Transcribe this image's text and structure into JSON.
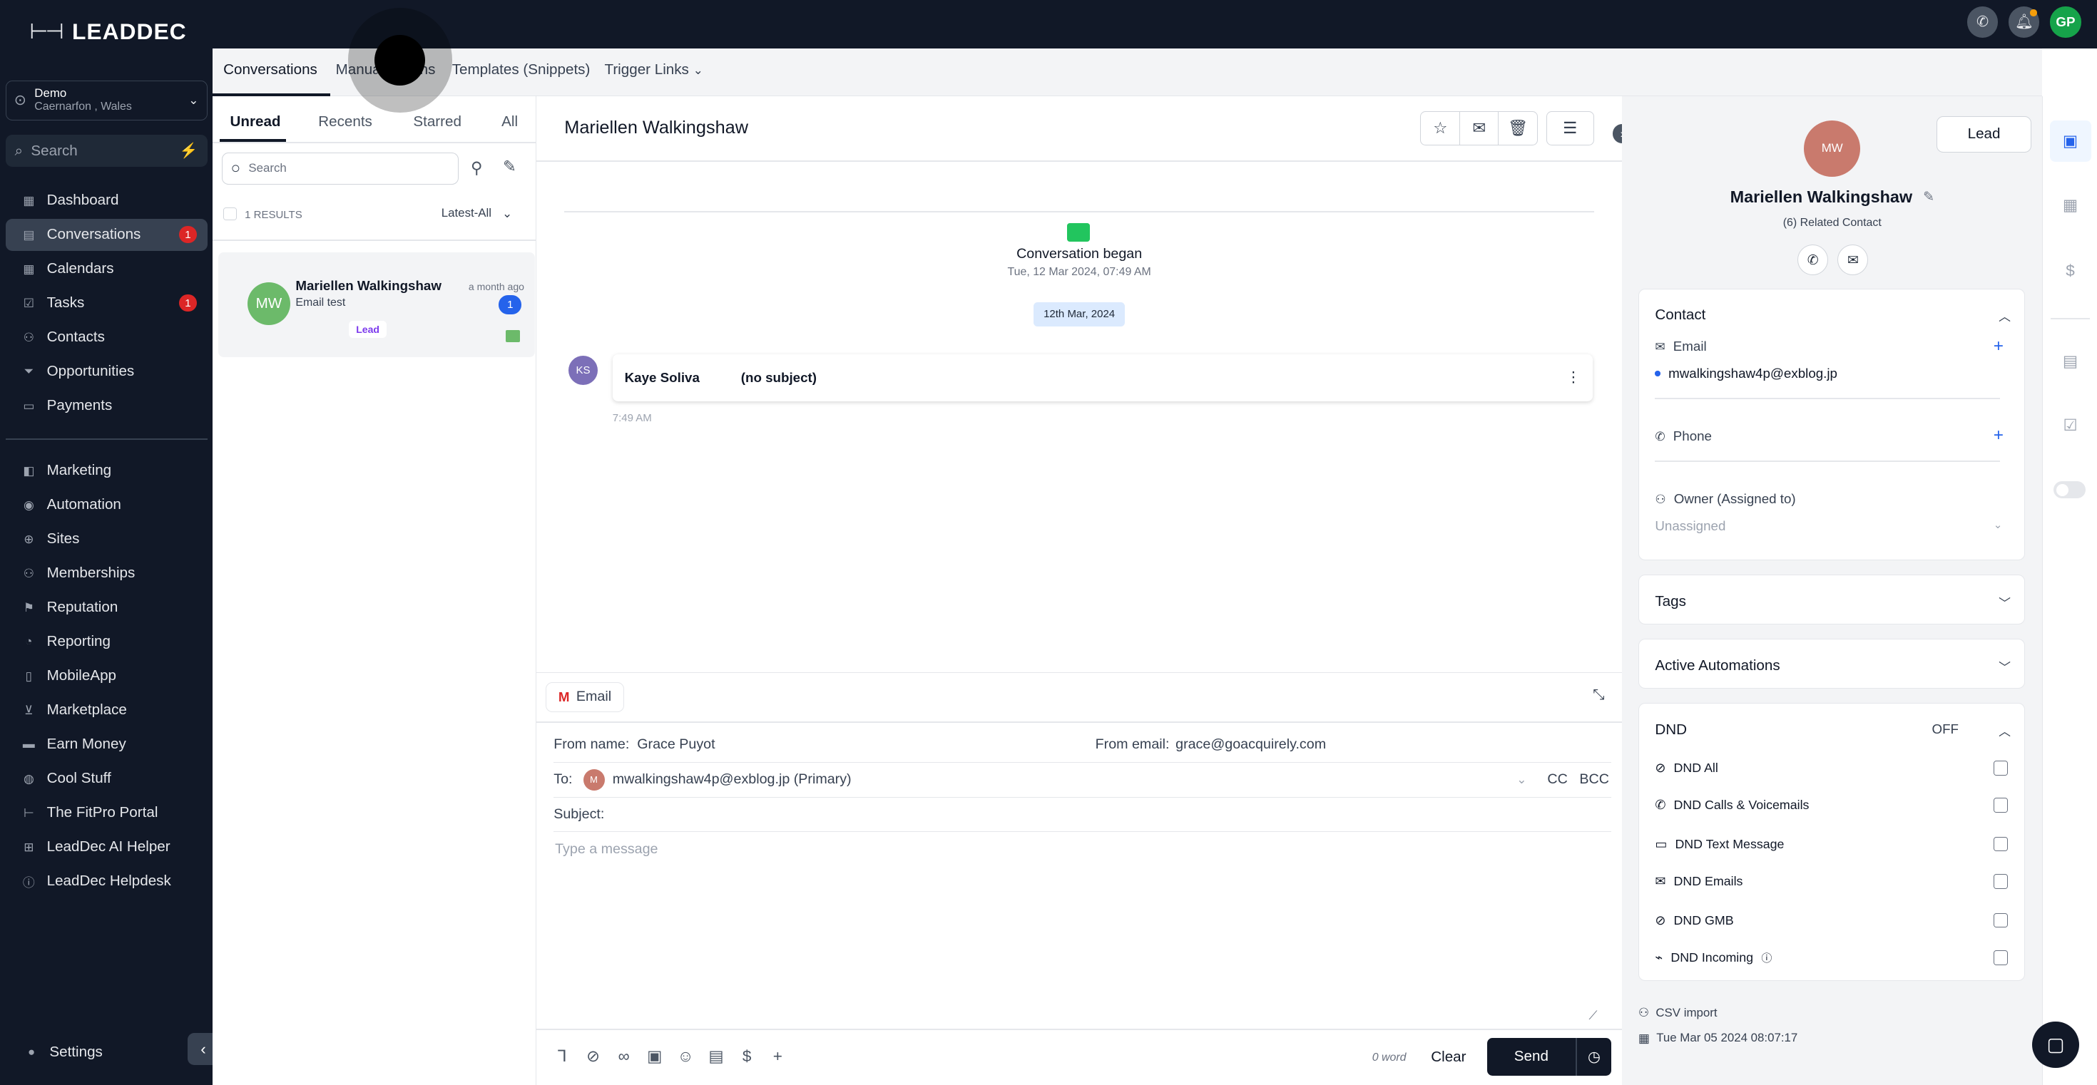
{
  "brand": {
    "logo_text": "LEADDEC"
  },
  "location": {
    "name": "Demo",
    "sub": "Caernarfon , Wales"
  },
  "sidebar_search_placeholder": "Search",
  "nav": [
    {
      "label": "Dashboard",
      "icon": "dashboard-icon"
    },
    {
      "label": "Conversations",
      "icon": "conversations-icon",
      "badge": "1",
      "active": true
    },
    {
      "label": "Calendars",
      "icon": "calendar-icon"
    },
    {
      "label": "Tasks",
      "icon": "tasks-icon",
      "badge": "1"
    },
    {
      "label": "Contacts",
      "icon": "contacts-icon"
    },
    {
      "label": "Opportunities",
      "icon": "opportunities-icon"
    },
    {
      "label": "Payments",
      "icon": "payments-icon"
    },
    {
      "label": "Marketing",
      "icon": "marketing-icon"
    },
    {
      "label": "Automation",
      "icon": "automation-icon"
    },
    {
      "label": "Sites",
      "icon": "sites-icon"
    },
    {
      "label": "Memberships",
      "icon": "memberships-icon"
    },
    {
      "label": "Reputation",
      "icon": "reputation-icon"
    },
    {
      "label": "Reporting",
      "icon": "reporting-icon"
    },
    {
      "label": "MobileApp",
      "icon": "mobile-icon"
    },
    {
      "label": "Marketplace",
      "icon": "cart-icon"
    },
    {
      "label": "Earn Money",
      "icon": "money-icon"
    },
    {
      "label": "Cool Stuff",
      "icon": "fire-icon"
    },
    {
      "label": "The FitPro Portal",
      "icon": "dumbbell-icon"
    },
    {
      "label": "LeadDec AI Helper",
      "icon": "robot-icon"
    },
    {
      "label": "LeadDec Helpdesk",
      "icon": "info-icon"
    }
  ],
  "settings_label": "Settings",
  "topbar": {
    "avatar_initials": "GP"
  },
  "top_tabs": [
    "Conversations",
    "Manual Actions",
    "Templates (Snippets)",
    "Trigger Links"
  ],
  "filter_tabs": [
    "Unread",
    "Recents",
    "Starred",
    "All"
  ],
  "list": {
    "search_placeholder": "Search",
    "results": "1 RESULTS",
    "sort": "Latest-All",
    "item": {
      "initials": "MW",
      "name": "Mariellen Walkingshaw",
      "preview": "Email test",
      "time": "a month ago",
      "count": "1",
      "tag": "Lead"
    }
  },
  "conversation": {
    "title": "Mariellen Walkingshaw",
    "began_label": "Conversation began",
    "began_time": "Tue, 12 Mar 2024, 07:49 AM",
    "date_chip": "12th Mar, 2024",
    "message": {
      "initials": "KS",
      "sender": "Kaye Soliva",
      "subject": "(no subject)",
      "time": "7:49 AM"
    }
  },
  "composer": {
    "channel": "Email",
    "from_name_label": "From name:",
    "from_name": "Grace Puyot",
    "from_email_label": "From email:",
    "from_email": "grace@goacquirely.com",
    "to_label": "To:",
    "to_initials": "M",
    "to_value": "mwalkingshaw4p@exblog.jp (Primary)",
    "cc": "CC",
    "bcc": "BCC",
    "subject_label": "Subject:",
    "message_placeholder": "Type a message",
    "word_count": "0 word",
    "clear": "Clear",
    "send": "Send"
  },
  "contact": {
    "initials": "MW",
    "name": "Mariellen Walkingshaw",
    "related": "(6) Related Contact",
    "lead_button": "Lead",
    "section_contact": "Contact",
    "email_label": "Email",
    "email_value": "mwalkingshaw4p@exblog.jp",
    "phone_label": "Phone",
    "owner_label": "Owner (Assigned to)",
    "owner_value": "Unassigned",
    "tags": "Tags",
    "active_automations": "Active Automations",
    "dnd": "DND",
    "dnd_state": "OFF",
    "dnd_items": [
      "DND All",
      "DND Calls & Voicemails",
      "DND Text Message",
      "DND Emails",
      "DND GMB",
      "DND Incoming"
    ],
    "source": "CSV import",
    "created": "Tue Mar 05 2024 08:07:17"
  },
  "colors": {
    "sidebar": "#111827",
    "accent": "#2563eb",
    "badge": "#dc2626",
    "avatar_mw": "#c97a6d",
    "avatar_list": "#6cba6a"
  }
}
